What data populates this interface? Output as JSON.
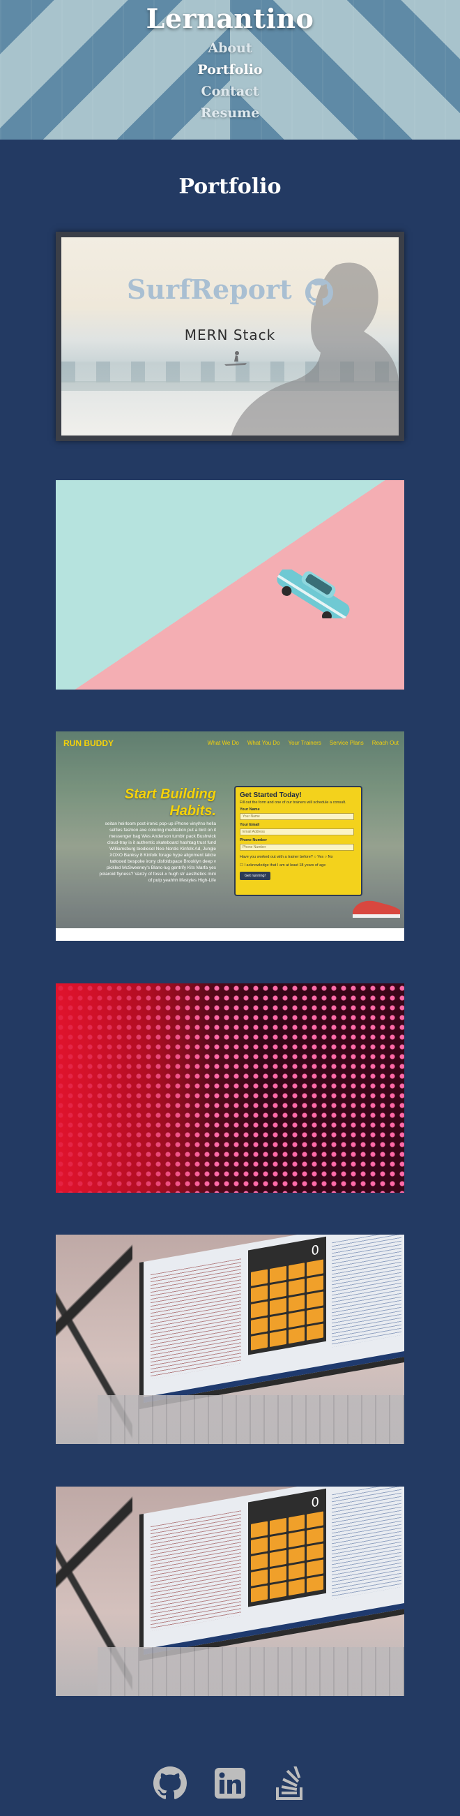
{
  "header": {
    "site_title": "Lernantino",
    "nav": [
      {
        "label": "About",
        "active": false
      },
      {
        "label": "Portfolio",
        "active": true
      },
      {
        "label": "Contact",
        "active": false
      },
      {
        "label": "Resume",
        "active": false
      }
    ]
  },
  "portfolio": {
    "title": "Portfolio",
    "projects": [
      {
        "title": "SurfReport",
        "subtitle": "MERN Stack",
        "icon": "github-icon"
      },
      {
        "image": "vintage-car-on-pastel-background"
      },
      {
        "image": "run-buddy-screenshot",
        "logo": "RUN BUDDY",
        "nav": [
          "What We Do",
          "What You Do",
          "Your Trainers",
          "Service Plans",
          "Reach Out"
        ],
        "headline": "Start Building Habits.",
        "body": "seitan heirloom post-ironic pop-up iPhone vinyl/no hella selfies fashion axe coloring meditation put a bird on it messenger bag Wes Anderson tumblr pack Bushwick cloud-tray is it authentic skateboard hashtag trust fund Williamsburg biodiesel Neo-Nordic Kinfolk Ad, Jungle XOXO Banksy 8 Kinfolk forage hype alignment lalicle tattooed bespoke irony disfoldspace Brooklyn deep v pickled McSweeney's Blanc-lug gentrify Kits Marfa yes polaroid flyness? Vanzy of fossil-x hugh str aesthetics mini of pulp yeahhh lifestyles High-Life",
        "form": {
          "title": "Get Started Today!",
          "description": "Fill out the form and one of our trainers will schedule a consult.",
          "name_label": "Your Name",
          "name_placeholder": "Your Name",
          "email_label": "Your Email",
          "email_placeholder": "Email Address",
          "phone_label": "Phone Number",
          "phone_placeholder": "Phone Number",
          "question": "Have you worked out with a trainer before?",
          "yes": "Yes",
          "no": "No",
          "checkbox_label": "I acknowledge that I am at least 18 years of age",
          "button": "Get running!"
        }
      },
      {
        "image": "red-led-wall"
      },
      {
        "image": "laptop-calculator-app",
        "calc_display": "0"
      },
      {
        "image": "laptop-calculator-app",
        "calc_display": "0"
      }
    ]
  },
  "footer": {
    "icons": [
      "github-icon",
      "linkedin-icon",
      "stackoverflow-icon"
    ]
  },
  "colors": {
    "page_background": "#233a63",
    "run_buddy_yellow": "#f5d20a",
    "surf_title": "#a9bfd2"
  }
}
